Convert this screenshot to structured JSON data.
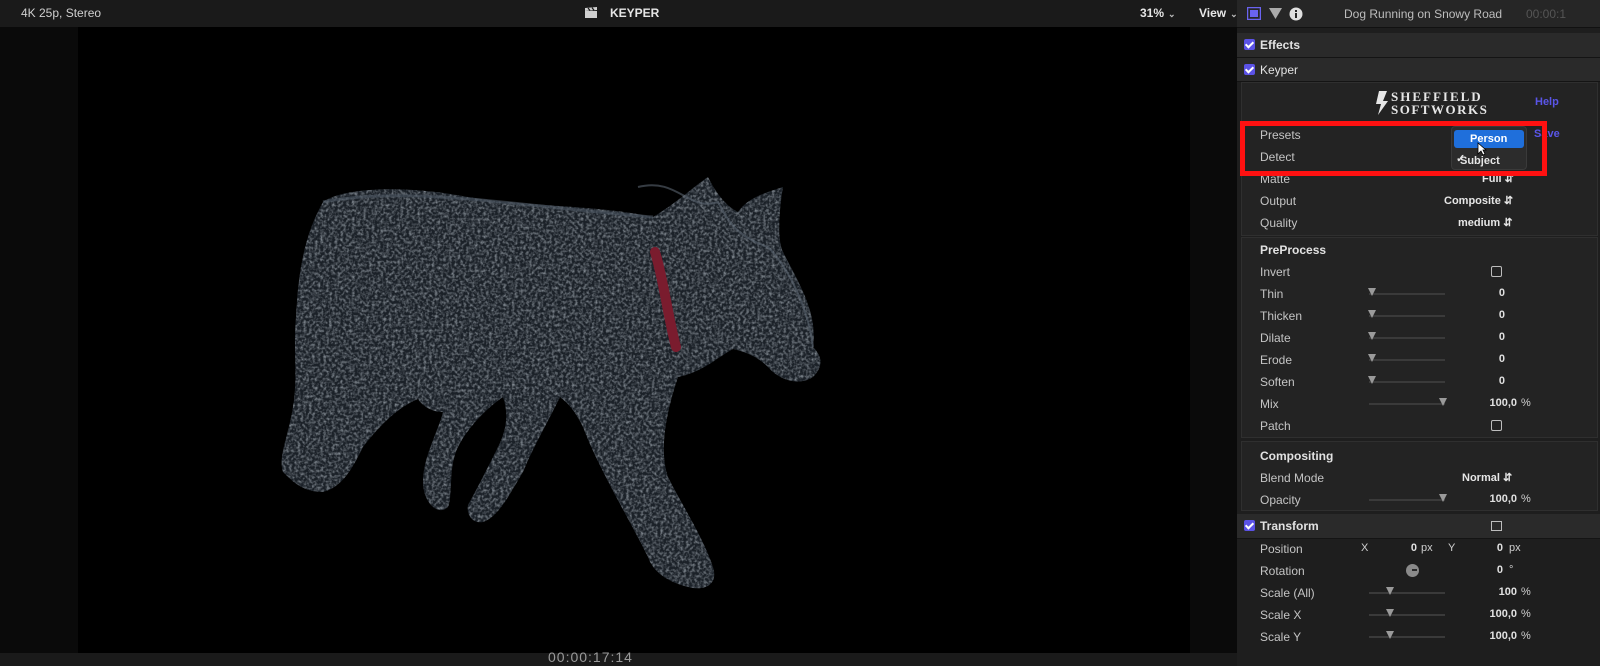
{
  "viewer": {
    "format": "4K 25p, Stereo",
    "title": "KEYPER",
    "zoom": "31%",
    "view_menu": "View",
    "timecode": "00:00:17:14"
  },
  "inspector": {
    "clip_name": "Dog Running on Snowy Road",
    "clip_time": "00:00:1",
    "effects_label": "Effects",
    "keyper": {
      "label": "Keyper",
      "logo_line1": "SHEFFIELD",
      "logo_line2": "SOFTWORKS",
      "help": "Help",
      "save": "Save",
      "presets_label": "Presets",
      "detect_label": "Detect",
      "matte_label": "Matte",
      "matte_value": "Full",
      "output_label": "Output",
      "output_value": "Composite",
      "quality_label": "Quality",
      "quality_value": "medium",
      "dropdown_options": [
        "Person",
        "Subject"
      ],
      "dropdown_selected": "Person",
      "dropdown_checked": "Subject",
      "preprocess": {
        "heading": "PreProcess",
        "invert_label": "Invert",
        "rows": [
          {
            "label": "Thin",
            "value": "0",
            "level": 0
          },
          {
            "label": "Thicken",
            "value": "0",
            "level": 0
          },
          {
            "label": "Dilate",
            "value": "0",
            "level": 0
          },
          {
            "label": "Erode",
            "value": "0",
            "level": 0
          },
          {
            "label": "Soften",
            "value": "0",
            "level": 0
          }
        ],
        "mix_label": "Mix",
        "mix_value": "100,0",
        "mix_unit": "%",
        "patch_label": "Patch"
      },
      "compositing": {
        "heading": "Compositing",
        "blend_label": "Blend Mode",
        "blend_value": "Normal",
        "opacity_label": "Opacity",
        "opacity_value": "100,0",
        "opacity_unit": "%"
      }
    },
    "transform": {
      "label": "Transform",
      "position_label": "Position",
      "x_label": "X",
      "x_value": "0",
      "y_label": "Y",
      "y_value": "0",
      "px_unit": "px",
      "rotation_label": "Rotation",
      "rotation_value": "0",
      "rotation_unit": "°",
      "scale_all_label": "Scale (All)",
      "scale_all_value": "100",
      "scale_x_label": "Scale X",
      "scale_x_value": "100,0",
      "scale_y_label": "Scale Y",
      "scale_y_value": "100,0",
      "percent_unit": "%"
    }
  },
  "colors": {
    "accent": "#5b52e6",
    "highlight_box": "#ff1111",
    "selection": "#1f6fdb"
  },
  "icons": [
    "clapper-icon",
    "video-inspector-icon",
    "filter-icon",
    "info-icon",
    "cursor-icon",
    "rotation-dial-icon"
  ]
}
